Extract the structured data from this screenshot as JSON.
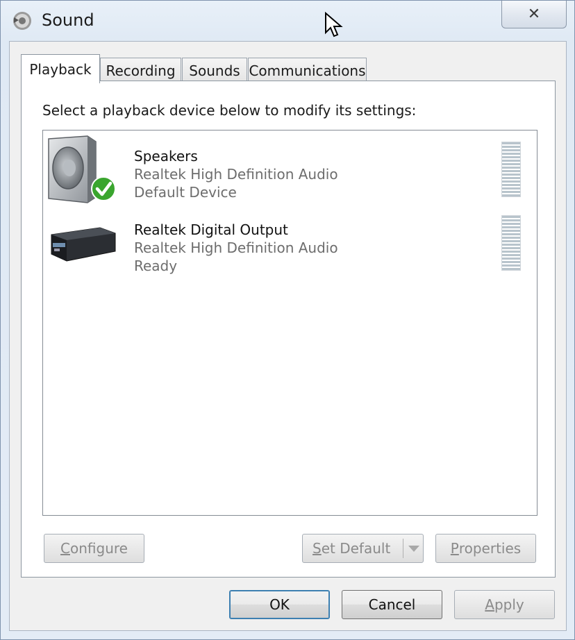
{
  "window": {
    "title": "Sound",
    "close_label": "✕"
  },
  "tabs": [
    {
      "label": "Playback",
      "active": true
    },
    {
      "label": "Recording",
      "active": false
    },
    {
      "label": "Sounds",
      "active": false
    },
    {
      "label": "Communications",
      "active": false
    }
  ],
  "playback": {
    "instruction": "Select a playback device below to modify its settings:",
    "devices": [
      {
        "name": "Speakers",
        "driver": "Realtek High Definition Audio",
        "status": "Default Device",
        "icon": "speaker-icon",
        "is_default": true
      },
      {
        "name": "Realtek Digital Output",
        "driver": "Realtek High Definition Audio",
        "status": "Ready",
        "icon": "digital-output-icon",
        "is_default": false
      }
    ],
    "buttons": {
      "configure_first": "C",
      "configure_rest": "onfigure",
      "set_default_first": "S",
      "set_default_rest": "et Default",
      "properties_first": "P",
      "properties_rest": "roperties"
    }
  },
  "dialog_buttons": {
    "ok": "OK",
    "cancel": "Cancel",
    "apply_first": "A",
    "apply_rest": "pply"
  },
  "colors": {
    "frame": "#dfe9f4",
    "client_bg": "#f0f0f0",
    "default_check": "#3aa52e"
  }
}
